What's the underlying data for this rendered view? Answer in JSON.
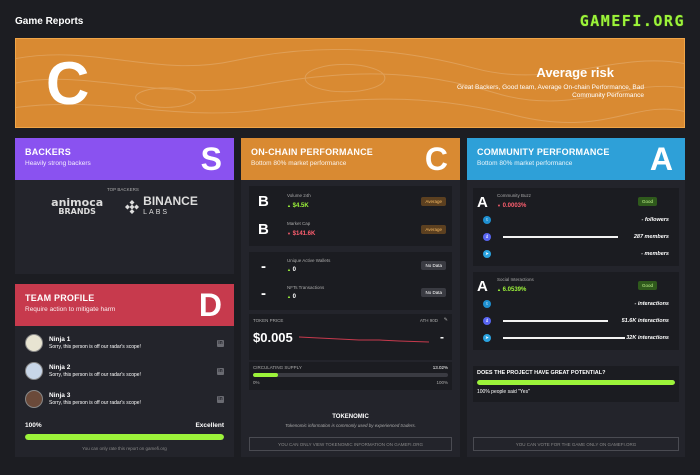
{
  "header": {
    "title": "Game Reports",
    "logo": "GAMEFI.ORG"
  },
  "hero": {
    "grade": "C",
    "title": "Average risk",
    "desc": "Great Backers, Good team, Average On-chain Performance, Bad Community Performance"
  },
  "backers": {
    "title": "BACKERS",
    "subtitle": "Heavily strong backers",
    "grade": "S",
    "top_label": "TOP BACKERS",
    "logo1_line1": "animoca",
    "logo1_line2": "BRANDS",
    "logo2_name": "BINANCE",
    "logo2_sub": "LABS"
  },
  "team": {
    "title": "TEAM PROFILE",
    "subtitle": "Require action to mitigate harm",
    "grade": "D",
    "members": [
      {
        "name": "Ninja 1",
        "note": "Sorry, this person is off our radar's scope!"
      },
      {
        "name": "Ninja 2",
        "note": "Sorry, this person is off our radar's scope!"
      },
      {
        "name": "Ninja 3",
        "note": "Sorry, this person is off our radar's scope!"
      }
    ],
    "score": "100%",
    "score_value": 100,
    "rating": "Excellent",
    "rate_note": "You can only rate this report on gamefi.org",
    "linkedin_glyph": "in"
  },
  "onchain": {
    "title": "ON-CHAIN PERFORMANCE",
    "subtitle": "Bottom 80% market performance",
    "grade": "C",
    "volume": {
      "grade": "B",
      "label": "Volume 24h",
      "arrow": "▲",
      "value": "$4.5K",
      "tag": "Average"
    },
    "mcap": {
      "grade": "B",
      "label": "Market Cap",
      "arrow": "▼",
      "value": "$141.6K",
      "tag": "Average"
    },
    "wallets": {
      "grade": "-",
      "label": "Unique Active Wallets",
      "arrow": "▲",
      "value": "0",
      "tag": "No Data"
    },
    "nft": {
      "grade": "-",
      "label": "NFTs Transactions",
      "arrow": "▲",
      "value": "0",
      "tag": "No Data"
    },
    "token": {
      "label": "TOKEN PRICE",
      "value": "$0.005",
      "range": "ATH 90D",
      "dash": "-"
    },
    "supply": {
      "label": "CIRCULATING SUPPLY",
      "percent": "13.02%",
      "fill": 13.02,
      "min": "0%",
      "max": "100%"
    },
    "tokenomic_title": "TOKENOMIC",
    "tokenomic_desc": "Tokenomic information is commonly used by experienced traders.",
    "button": "YOU CAN ONLY VIEW TOKENOMIC INFORMATION ON GAMEFI.ORG"
  },
  "community": {
    "title": "COMMUNITY PERFORMANCE",
    "subtitle": "Bottom 80% market performance",
    "grade": "A",
    "buzz": {
      "grade": "A",
      "label": "Community Buzz",
      "arrow": "▼",
      "value": "0.0003%",
      "tag": "Good"
    },
    "buzz_rows": [
      {
        "icon": "twitter",
        "count": "- followers"
      },
      {
        "icon": "discord",
        "count": "287 members"
      },
      {
        "icon": "telegram",
        "count": "- members"
      }
    ],
    "social": {
      "grade": "A",
      "label": "Social Interactions",
      "arrow": "▲",
      "value": "6.0539%",
      "tag": "Good"
    },
    "social_rows": [
      {
        "icon": "twitter",
        "count": "- interactions"
      },
      {
        "icon": "discord",
        "count": "51.6K interactions"
      },
      {
        "icon": "telegram",
        "count": "32K interactions"
      }
    ],
    "question": "DOES THE PROJECT HAVE GREAT POTENTIAL?",
    "vote_percent": 100,
    "vote_result": "100% people said \"Yes\"",
    "button": "YOU CAN VOTE FOR THE GAME ONLY ON GAMEFI.ORG"
  },
  "colors": {
    "accent": "#9cf33a",
    "orange": "#d98a32",
    "purple": "#8a52f0",
    "cyan": "#2ea0d8",
    "red": "#c73a4d"
  }
}
